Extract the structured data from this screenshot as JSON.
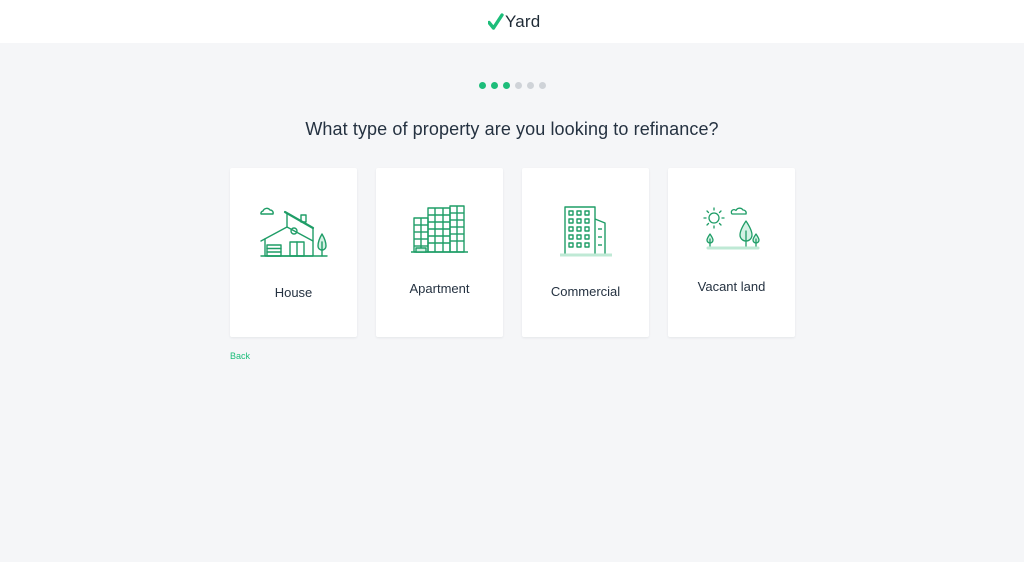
{
  "brand": {
    "name": "Yard",
    "accent_color": "#1dbd7a"
  },
  "progress": {
    "completed": 3,
    "total": 6
  },
  "question": "What type of property are you looking to refinance?",
  "options": [
    {
      "label": "House",
      "icon": "house-icon"
    },
    {
      "label": "Apartment",
      "icon": "apartment-building-icon"
    },
    {
      "label": "Commercial",
      "icon": "commercial-building-icon"
    },
    {
      "label": "Vacant land",
      "icon": "vacant-land-icon"
    }
  ],
  "back_label": "Back"
}
